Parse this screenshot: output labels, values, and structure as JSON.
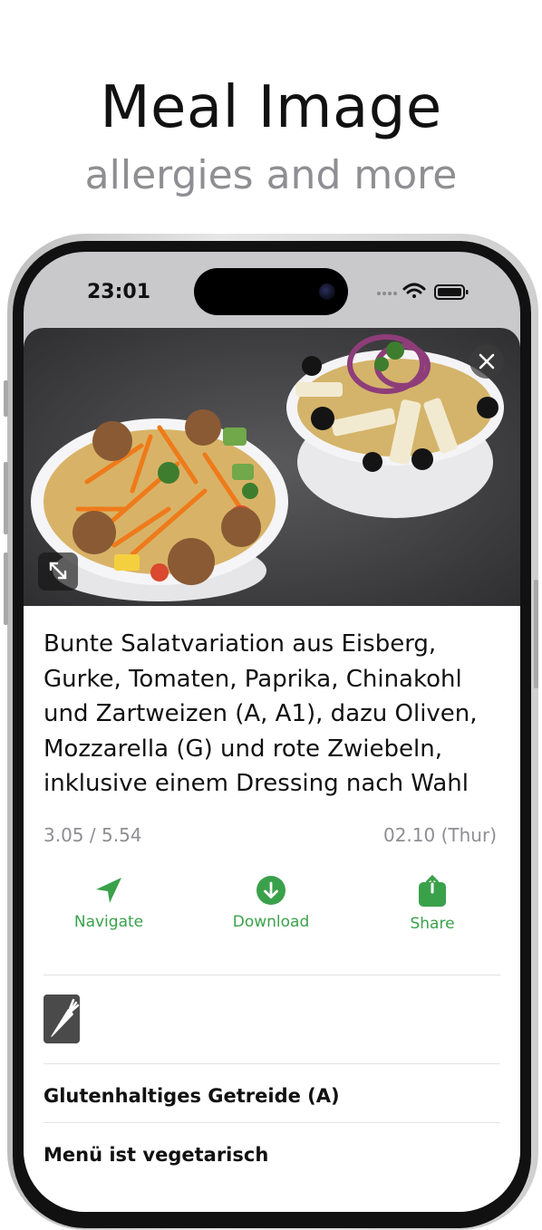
{
  "hero": {
    "title": "Meal Image",
    "subtitle": "allergies and more"
  },
  "status_bar": {
    "time": "23:01",
    "icons": [
      "signal-dots-icon",
      "wifi-icon",
      "battery-icon"
    ]
  },
  "meal": {
    "photo": "salad-bowls-photo",
    "description": "Bunte Salatvariation aus Eisberg, Gurke, Tomaten, Paprika, Chinakohl und Zartweizen (A, A1), dazu Oliven, Mozzarella (G) und rote Zwiebeln, inklusive einem Dressing nach Wahl",
    "price": "3.05 / 5.54",
    "date": "02.10 (Thur)"
  },
  "actions": {
    "navigate": "Navigate",
    "download": "Download",
    "share": "Share"
  },
  "badges": [
    "carrot-icon"
  ],
  "info_rows": [
    "Glutenhaltiges Getreide (A)",
    "Menü ist vegetarisch"
  ],
  "colors": {
    "accent": "#3aa14b",
    "secondary_text": "#8e8e93"
  }
}
